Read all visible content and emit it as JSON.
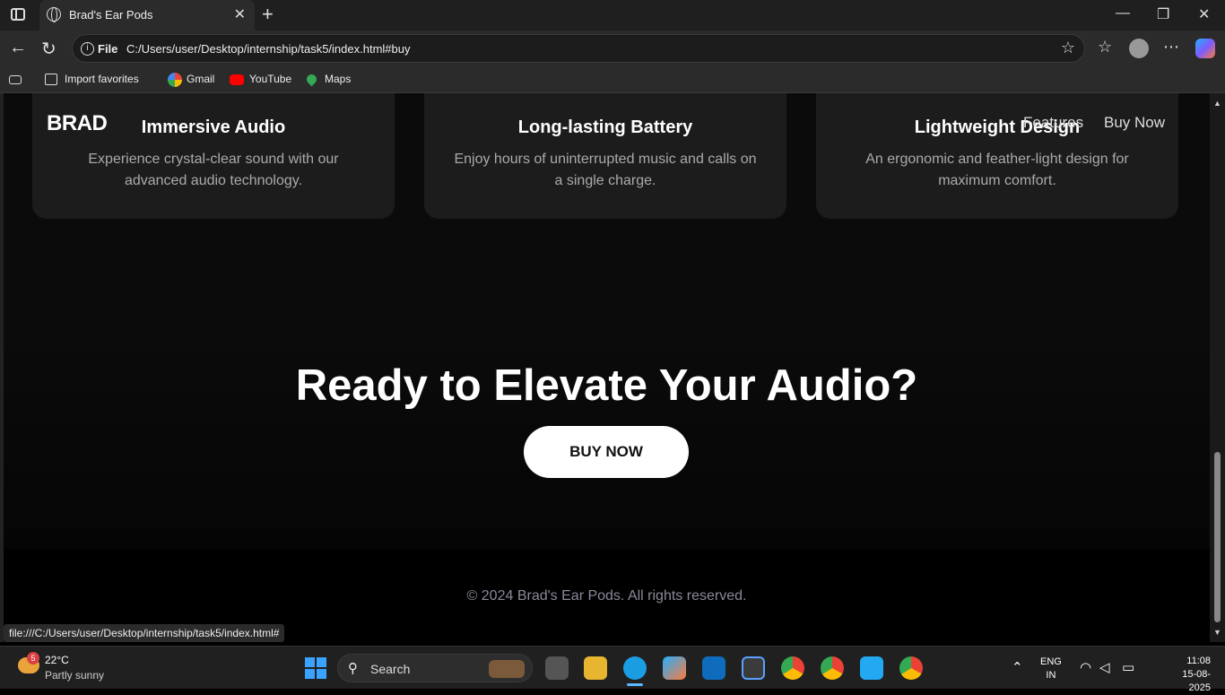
{
  "browser": {
    "tab_title": "Brad's Ear Pods",
    "url_protocol": "File",
    "url": "C:/Users/user/Desktop/internship/task5/index.html#buy",
    "favorites": [
      "Import favorites",
      "Gmail",
      "YouTube",
      "Maps"
    ],
    "status_url": "file:///C:/Users/user/Desktop/internship/task5/index.html#"
  },
  "page": {
    "nav": {
      "logo": "BRAD",
      "links": [
        "Features",
        "Buy Now"
      ]
    },
    "features": [
      {
        "title": "Immersive Audio",
        "desc": "Experience crystal-clear sound with our advanced audio technology."
      },
      {
        "title": "Long-lasting Battery",
        "desc": "Enjoy hours of uninterrupted music and calls on a single charge."
      },
      {
        "title": "Lightweight Design",
        "desc": "An ergonomic and feather-light design for maximum comfort."
      }
    ],
    "cta": {
      "heading": "Ready to Elevate Your Audio?",
      "button": "BUY NOW"
    },
    "footer": "© 2024 Brad's Ear Pods. All rights reserved."
  },
  "taskbar": {
    "weather": {
      "temp": "22°C",
      "condition": "Partly sunny",
      "badge": "5"
    },
    "search_label": "Search",
    "lang": [
      "ENG",
      "IN"
    ],
    "time": "11:08",
    "date": "15-08-2025"
  }
}
